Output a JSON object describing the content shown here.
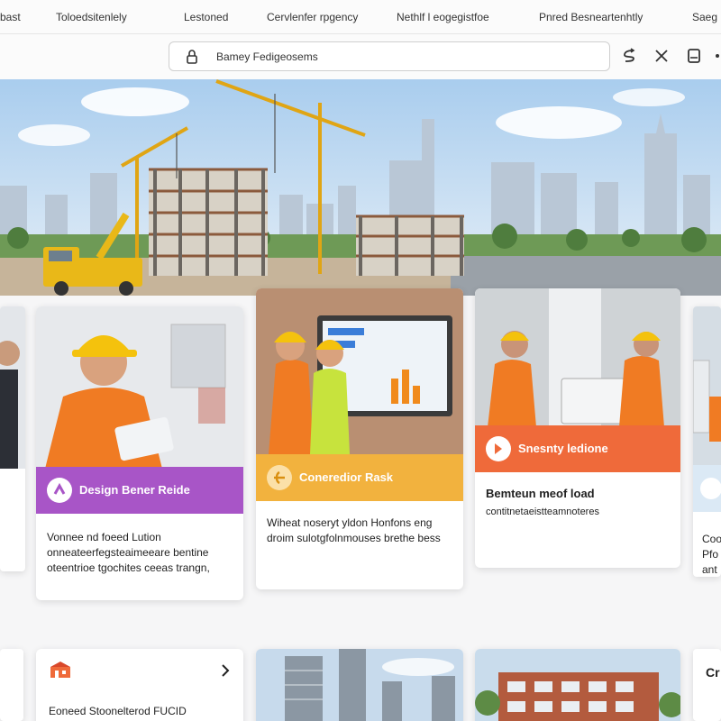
{
  "nav": {
    "items": [
      "bast",
      "Toloedsitenlely",
      "Lestoned",
      "Cervlenfer rpgency",
      "Nethlf l eogegistfoe",
      "Pnred Besneartenhtly",
      "Saeg"
    ]
  },
  "search": {
    "value": "Bamey Fedigeosems"
  },
  "toolbar": {
    "icons": [
      "share-icon",
      "collapse-icon",
      "bookmark-icon"
    ]
  },
  "cards": [
    {
      "band_title": "Design Bener Reide",
      "band_color": "#a855c7",
      "description": "Vonnee nd foeed Lution onneateerfegsteaimeeare bentine oteentrioe tgochites ceeas trangn,"
    },
    {
      "band_title": "Coneredior Rask",
      "band_color": "#f2b23e",
      "description": "Wiheat noseryt yldon Honfons eng droim sulotgfolnmouses brethe bess"
    },
    {
      "band_title": "Snesnty ledione",
      "band_color": "#ef6a3a",
      "subtitle": "Bemteun meof load",
      "description": "contitnetaeistteamnoteres"
    }
  ],
  "side_cards": [
    {
      "title": "Coo",
      "lines": [
        "Pfo",
        "ant"
      ]
    }
  ],
  "bottom": {
    "card1_title": "Eoneed Stoonelterod FUCID",
    "card4_title": "Cr"
  },
  "colors": {
    "accent_purple": "#a855c7",
    "accent_yellow": "#f2b23e",
    "accent_orange": "#ef6a3a",
    "accent_blue": "#5aa0d8"
  }
}
